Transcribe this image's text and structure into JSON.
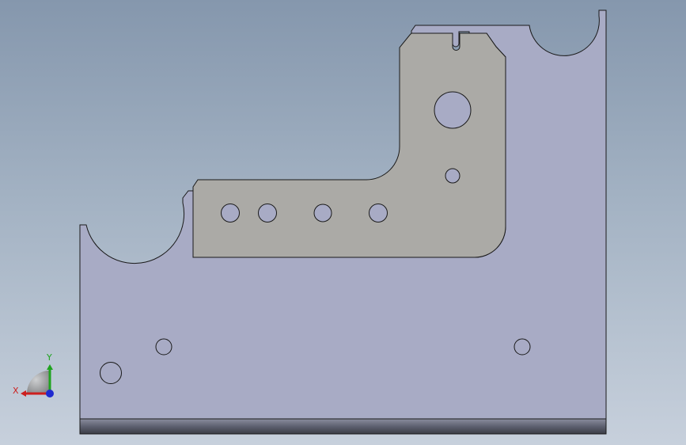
{
  "viewport": {
    "background_top": "#8597ad",
    "background_bottom": "#c7d0dc"
  },
  "part": {
    "face_color": "#a8abc5",
    "edge_color": "#1a1a1a",
    "bracket_color": "#abaaa6",
    "base_edge_color": "#5d6070"
  },
  "triad": {
    "x_label": "X",
    "y_label": "Y",
    "x_color": "#cc1f1f",
    "y_color": "#1fa31f",
    "z_color": "#1f2ad0"
  }
}
